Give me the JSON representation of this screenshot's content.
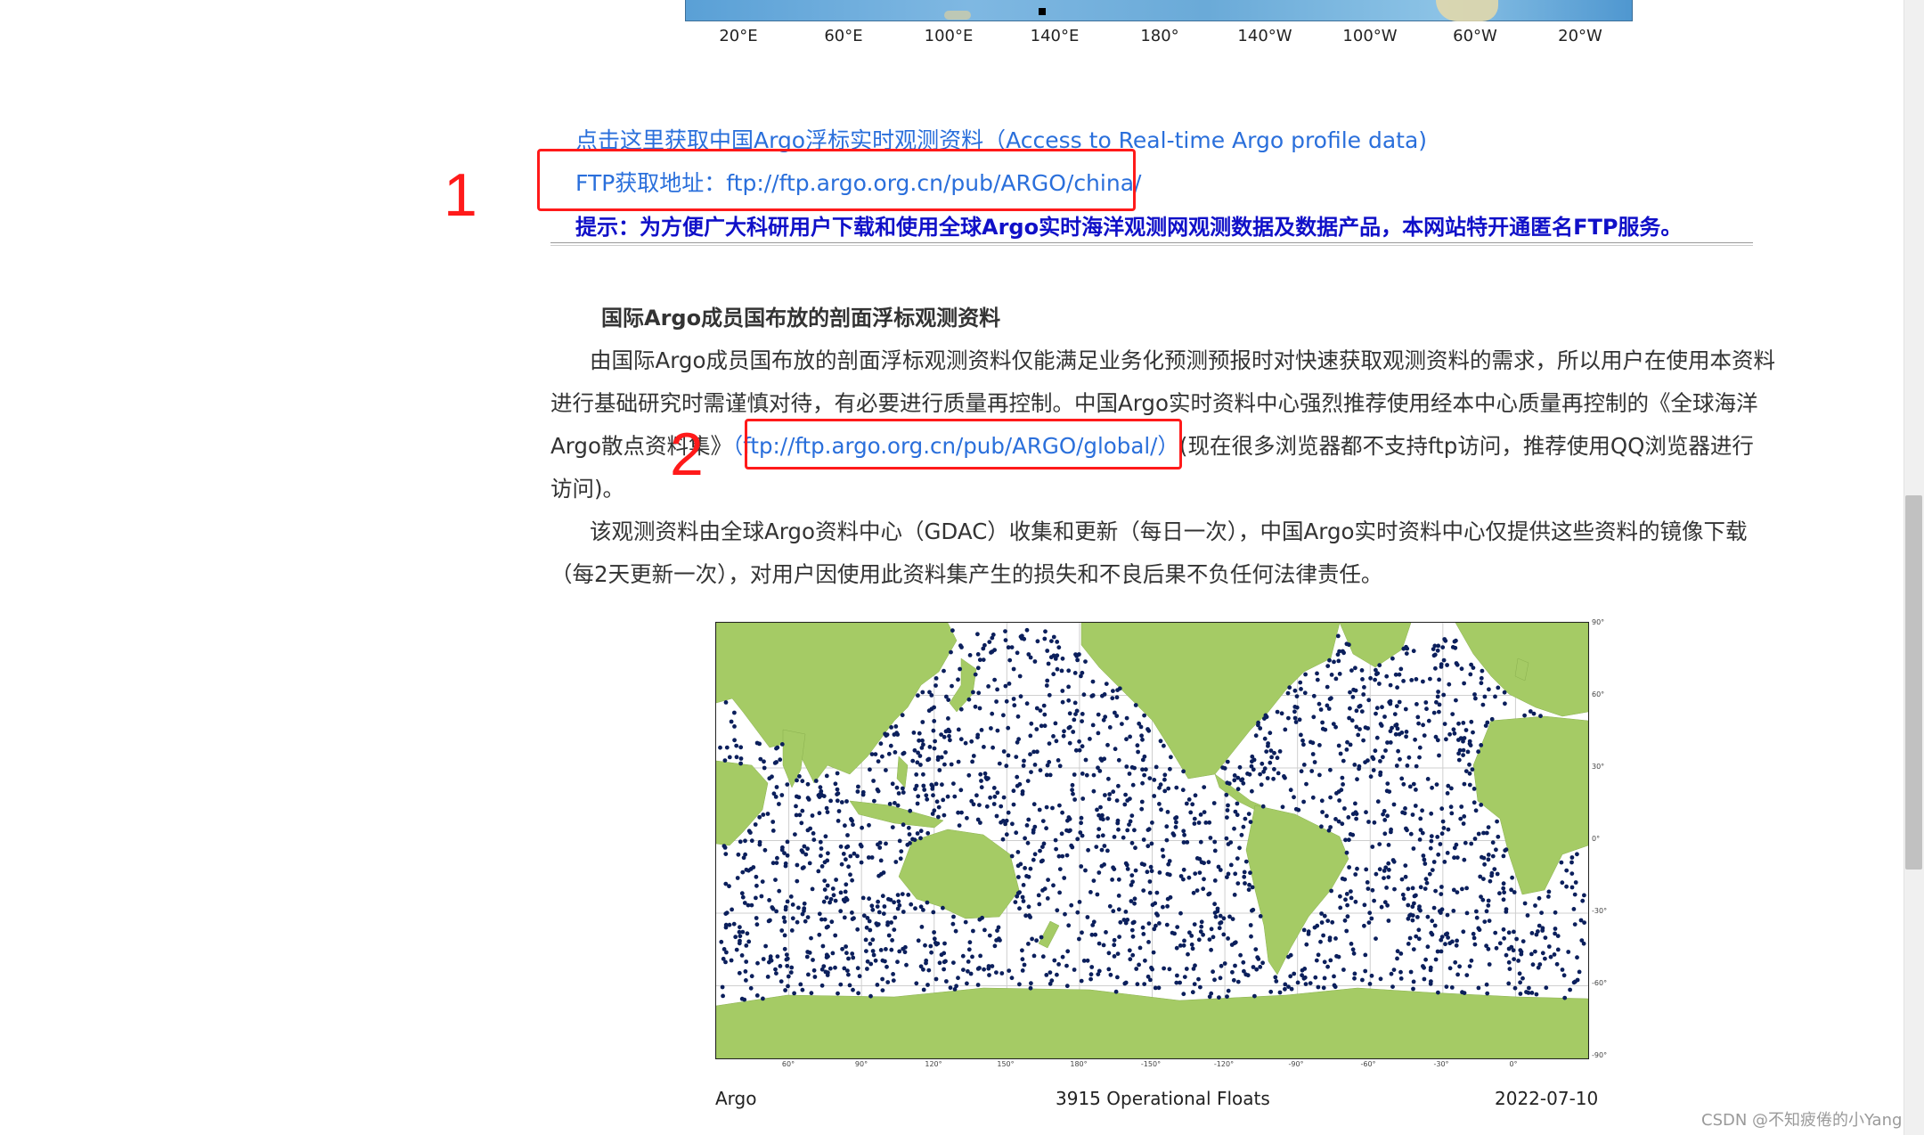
{
  "top_map": {
    "tick_labels": [
      "20°E",
      "60°E",
      "100°E",
      "140°E",
      "180°",
      "140°W",
      "100°W",
      "60°W",
      "20°W"
    ]
  },
  "links": {
    "realtime": "点击这里获取中国Argo浮标实时观测资料（Access to Real-time Argo profile data)",
    "ftp": "FTP获取地址：ftp://ftp.argo.org.cn/pub/ARGO/china/"
  },
  "notice": "提示：为方便广大科研用户下载和使用全球Argo实时海洋观测网观测数据及数据产品，本网站特开通匿名FTP服务。",
  "section": {
    "heading": "国际Argo成员国布放的剖面浮标观测资料",
    "p1_line1": "由国际Argo成员国布放的剖面浮标观测资料仅能满足业务化预测预报时对快速获取观测资料的需求，所以用户在使用本资料",
    "p1_line2": "进行基础研究时需谨慎对待，有必要进行质量再控制。中国Argo实时资料中心强烈推荐使用经本中心质量再控制的《全球海洋",
    "p1_line3_pre": "Argo散点资料集》",
    "p1_line3_link": "（ftp://ftp.argo.org.cn/pub/ARGO/global/）",
    "p1_line3_post": "(现在很多浏览器都不支持ftp访问，推荐使用QQ浏览器进行",
    "p1_line4": "访问)。",
    "p2_line1": "该观测资料由全球Argo资料中心（GDAC）收集和更新（每日一次），中国Argo实时资料中心仅提供这些资料的镜像下载",
    "p2_line2": "（每2天更新一次），对用户因使用此资料集产生的损失和不良后果不负任何法律责任。"
  },
  "annotations": {
    "num1": "1",
    "num2": "2",
    "color": "#ff1a1a"
  },
  "float_map": {
    "lat_labels": [
      "90°",
      "60°",
      "30°",
      "0°",
      "-30°",
      "-60°",
      "-90°"
    ],
    "lon_labels": [
      "60°",
      "90°",
      "120°",
      "150°",
      "180°",
      "-150°",
      "-120°",
      "-90°",
      "-60°",
      "-30°",
      "0°"
    ],
    "caption_left": "Argo",
    "caption_center": "3915 Operational Floats",
    "caption_right": "2022-07-10",
    "land_color": "#a5cb65",
    "float_color": "#0b1f5c"
  },
  "watermark": "CSDN @不知疲倦的小Yang"
}
